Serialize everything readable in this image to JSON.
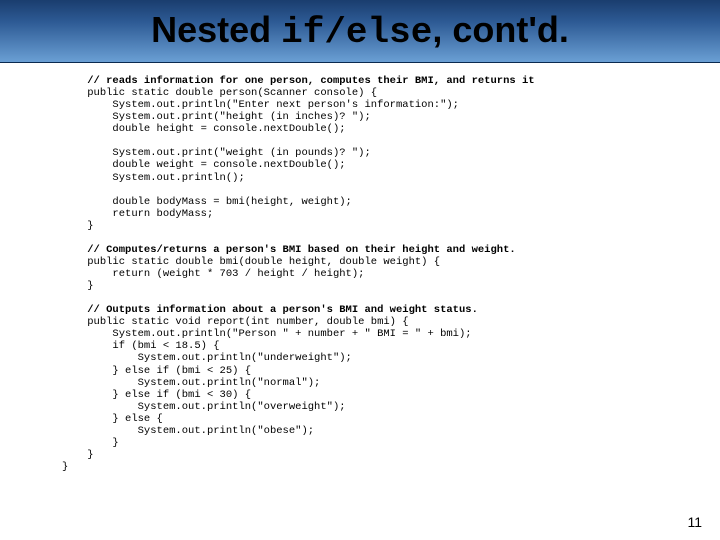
{
  "title": {
    "part1": "Nested ",
    "mono": "if/else",
    "part2": ", cont'd."
  },
  "code": {
    "c1": "// reads information for one person, computes their BMI, and returns it",
    "l2": "public static double person(Scanner console) {",
    "l3": "    System.out.println(\"Enter next person's information:\");",
    "l4": "    System.out.print(\"height (in inches)? \");",
    "l5": "    double height = console.nextDouble();",
    "l6": "",
    "l7": "    System.out.print(\"weight (in pounds)? \");",
    "l8": "    double weight = console.nextDouble();",
    "l9": "    System.out.println();",
    "l10": "",
    "l11": "    double bodyMass = bmi(height, weight);",
    "l12": "    return bodyMass;",
    "l13": "}",
    "l14": "",
    "c15": "// Computes/returns a person's BMI based on their height and weight.",
    "l16": "public static double bmi(double height, double weight) {",
    "l17": "    return (weight * 703 / height / height);",
    "l18": "}",
    "l19": "",
    "c20": "// Outputs information about a person's BMI and weight status.",
    "l21": "public static void report(int number, double bmi) {",
    "l22": "    System.out.println(\"Person \" + number + \" BMI = \" + bmi);",
    "l23": "    if (bmi < 18.5) {",
    "l24": "        System.out.println(\"underweight\");",
    "l25": "    } else if (bmi < 25) {",
    "l26": "        System.out.println(\"normal\");",
    "l27": "    } else if (bmi < 30) {",
    "l28": "        System.out.println(\"overweight\");",
    "l29": "    } else {",
    "l30": "        System.out.println(\"obese\");",
    "l31": "    }",
    "l32": "}",
    "lend": "}"
  },
  "page_number": "11"
}
